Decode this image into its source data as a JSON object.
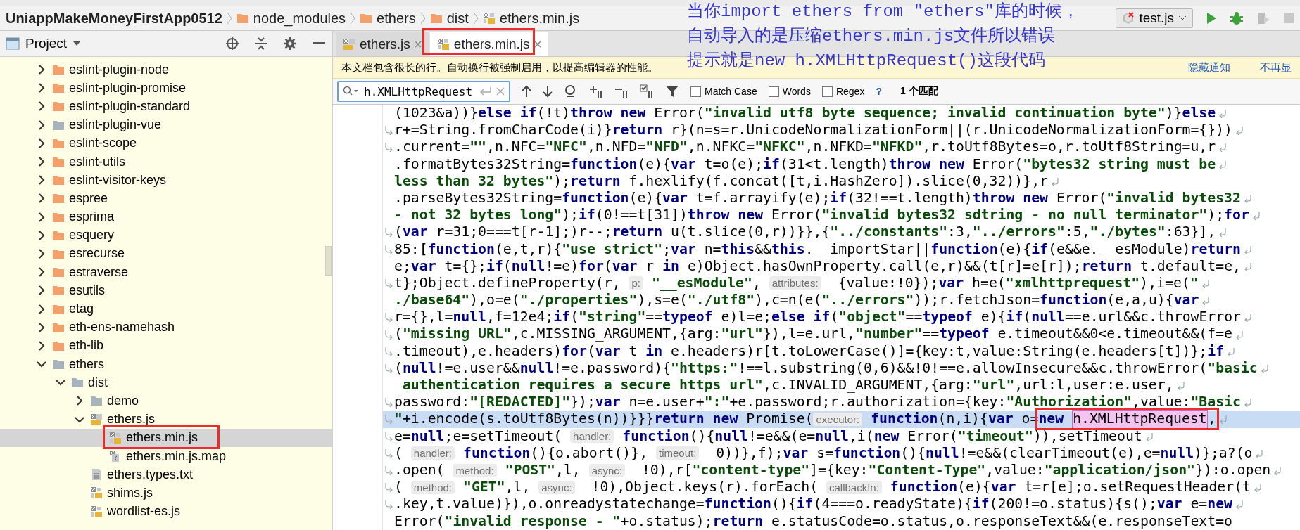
{
  "breadcrumb": [
    {
      "label": "UniappMakeMoneyFirstApp0512",
      "kind": "project"
    },
    {
      "label": "node_modules",
      "kind": "folder"
    },
    {
      "label": "ethers",
      "kind": "folder"
    },
    {
      "label": "dist",
      "kind": "folder"
    },
    {
      "label": "ethers.min.js",
      "kind": "minjs"
    }
  ],
  "run_config": {
    "label": "test.js"
  },
  "project_panel": {
    "title": "Project",
    "tree": [
      {
        "name": "eslint-plugin-node",
        "kind": "folder",
        "expanded": false,
        "selected": false
      },
      {
        "name": "eslint-plugin-promise",
        "kind": "folder",
        "expanded": false,
        "selected": false
      },
      {
        "name": "eslint-plugin-standard",
        "kind": "folder",
        "expanded": false,
        "selected": false
      },
      {
        "name": "eslint-plugin-vue",
        "kind": "greyfolder",
        "expanded": false,
        "selected": false
      },
      {
        "name": "eslint-scope",
        "kind": "folder",
        "expanded": false,
        "selected": false
      },
      {
        "name": "eslint-utils",
        "kind": "folder",
        "expanded": false,
        "selected": false
      },
      {
        "name": "eslint-visitor-keys",
        "kind": "folder",
        "expanded": false,
        "selected": false
      },
      {
        "name": "espree",
        "kind": "folder",
        "expanded": false,
        "selected": false
      },
      {
        "name": "esprima",
        "kind": "folder",
        "expanded": false,
        "selected": false
      },
      {
        "name": "esquery",
        "kind": "folder",
        "expanded": false,
        "selected": false
      },
      {
        "name": "esrecurse",
        "kind": "folder",
        "expanded": false,
        "selected": false
      },
      {
        "name": "estraverse",
        "kind": "folder",
        "expanded": false,
        "selected": false
      },
      {
        "name": "esutils",
        "kind": "folder",
        "expanded": false,
        "selected": false
      },
      {
        "name": "etag",
        "kind": "folder",
        "expanded": false,
        "selected": false
      },
      {
        "name": "eth-ens-namehash",
        "kind": "folder",
        "expanded": false,
        "selected": false
      },
      {
        "name": "eth-lib",
        "kind": "folder",
        "expanded": false,
        "selected": false
      },
      {
        "name": "ethers",
        "kind": "greyfolder",
        "expanded": true,
        "selected": false,
        "children": [
          {
            "name": "dist",
            "kind": "greyfolder",
            "expanded": true,
            "selected": false,
            "children": [
              {
                "name": "demo",
                "kind": "greyfolder",
                "expanded": false,
                "selected": false
              },
              {
                "name": "ethers.js",
                "kind": "js",
                "expanded": true,
                "selected": false,
                "children": [
                  {
                    "name": "ethers.min.js",
                    "kind": "minjs",
                    "selected": true
                  },
                  {
                    "name": "ethers.min.js.map",
                    "kind": "map",
                    "selected": false
                  }
                ]
              },
              {
                "name": "ethers.types.txt",
                "kind": "text",
                "selected": false
              },
              {
                "name": "shims.js",
                "kind": "minjs",
                "selected": false
              },
              {
                "name": "wordlist-es.js",
                "kind": "minjs",
                "selected": false
              }
            ]
          }
        ]
      }
    ]
  },
  "editor_tabs": [
    {
      "label": "ethers.js",
      "kind": "js",
      "selected": false
    },
    {
      "label": "ethers.min.js",
      "kind": "minjs",
      "selected": true
    }
  ],
  "notification": {
    "message": "本文档包含很长的行。自动换行被强制启用，以提高编辑器的性能。",
    "actions": [
      "隐藏通知",
      "不再显"
    ]
  },
  "search": {
    "value": "h.XMLHttpRequest",
    "options": [
      {
        "label": "Match Case",
        "checked": false
      },
      {
        "label": "Words",
        "checked": false
      },
      {
        "label": "Regex",
        "checked": false
      }
    ],
    "help": "?",
    "result": "1 个匹配"
  },
  "code_lines": [
    {
      "wrap_mark": false,
      "current": false,
      "tokens": [
        {
          "kind": "plain",
          "text": "(1023&a))}"
        },
        {
          "kind": "keyword",
          "text": "else if"
        },
        {
          "kind": "plain",
          "text": "(!t)"
        },
        {
          "kind": "keyword",
          "text": "throw new"
        },
        {
          "kind": "plain",
          "text": " Error("
        },
        {
          "kind": "string",
          "text": "\"invalid utf8 byte sequence; invalid continuation byte\""
        },
        {
          "kind": "plain",
          "text": ")}"
        },
        {
          "kind": "keyword",
          "text": "else"
        }
      ]
    },
    {
      "wrap_mark": true,
      "current": false,
      "tokens": [
        {
          "kind": "plain",
          "text": "r+=String.fromCharCode(i)}"
        },
        {
          "kind": "keyword",
          "text": "return"
        },
        {
          "kind": "plain",
          "text": " r}(n=s=r.UnicodeNormalizationForm||(r.UnicodeNormalizationForm={}))"
        }
      ]
    },
    {
      "wrap_mark": true,
      "current": false,
      "tokens": [
        {
          "kind": "plain",
          "text": ".current="
        },
        {
          "kind": "string",
          "text": "\"\""
        },
        {
          "kind": "plain",
          "text": ",n.NFC="
        },
        {
          "kind": "string",
          "text": "\"NFC\""
        },
        {
          "kind": "plain",
          "text": ",n.NFD="
        },
        {
          "kind": "string",
          "text": "\"NFD\""
        },
        {
          "kind": "plain",
          "text": ",n.NFKC="
        },
        {
          "kind": "string",
          "text": "\"NFKC\""
        },
        {
          "kind": "plain",
          "text": ",n.NFKD="
        },
        {
          "kind": "string",
          "text": "\"NFKD\""
        },
        {
          "kind": "plain",
          "text": ",r.toUtf8Bytes=o,r.toUtf8String=u,r"
        }
      ]
    },
    {
      "wrap_mark": false,
      "current": false,
      "tokens": [
        {
          "kind": "plain",
          "text": ".formatBytes32String="
        },
        {
          "kind": "keyword",
          "text": "function"
        },
        {
          "kind": "plain",
          "text": "(e){"
        },
        {
          "kind": "keyword",
          "text": "var"
        },
        {
          "kind": "plain",
          "text": " t=o(e);"
        },
        {
          "kind": "keyword",
          "text": "if"
        },
        {
          "kind": "plain",
          "text": "(31<t.length)"
        },
        {
          "kind": "keyword",
          "text": "throw new"
        },
        {
          "kind": "plain",
          "text": " Error("
        },
        {
          "kind": "string",
          "text": "\"bytes32 string must be"
        }
      ]
    },
    {
      "wrap_mark": false,
      "current": false,
      "tokens": [
        {
          "kind": "string",
          "text": "less than 32 bytes\""
        },
        {
          "kind": "plain",
          "text": ");"
        },
        {
          "kind": "keyword",
          "text": "return"
        },
        {
          "kind": "plain",
          "text": " f.hexlify(f.concat([t,i.HashZero]).slice(0,32))},r"
        }
      ]
    },
    {
      "wrap_mark": false,
      "current": false,
      "tokens": [
        {
          "kind": "plain",
          "text": ".parseBytes32String="
        },
        {
          "kind": "keyword",
          "text": "function"
        },
        {
          "kind": "plain",
          "text": "(e){"
        },
        {
          "kind": "keyword",
          "text": "var"
        },
        {
          "kind": "plain",
          "text": " t=f.arrayify(e);"
        },
        {
          "kind": "keyword",
          "text": "if"
        },
        {
          "kind": "plain",
          "text": "(32!==t.length)"
        },
        {
          "kind": "keyword",
          "text": "throw new"
        },
        {
          "kind": "plain",
          "text": " Error("
        },
        {
          "kind": "string",
          "text": "\"invalid bytes32"
        }
      ]
    },
    {
      "wrap_mark": false,
      "current": false,
      "tokens": [
        {
          "kind": "string",
          "text": "- not 32 bytes long\""
        },
        {
          "kind": "plain",
          "text": ");"
        },
        {
          "kind": "keyword",
          "text": "if"
        },
        {
          "kind": "plain",
          "text": "(0!==t[31])"
        },
        {
          "kind": "keyword",
          "text": "throw new"
        },
        {
          "kind": "plain",
          "text": " Error("
        },
        {
          "kind": "string",
          "text": "\"invalid bytes32 sdtring - no null terminator\""
        },
        {
          "kind": "plain",
          "text": ");"
        },
        {
          "kind": "keyword",
          "text": "for"
        }
      ]
    },
    {
      "wrap_mark": true,
      "current": false,
      "tokens": [
        {
          "kind": "plain",
          "text": "("
        },
        {
          "kind": "keyword",
          "text": "var"
        },
        {
          "kind": "plain",
          "text": " r=31;0===t[r-1];)r--;"
        },
        {
          "kind": "keyword",
          "text": "return"
        },
        {
          "kind": "plain",
          "text": " u(t.slice(0,r))}},{"
        },
        {
          "kind": "string",
          "text": "\"../constants\""
        },
        {
          "kind": "plain",
          "text": ":3,"
        },
        {
          "kind": "string",
          "text": "\"../errors\""
        },
        {
          "kind": "plain",
          "text": ":5,"
        },
        {
          "kind": "string",
          "text": "\"./bytes\""
        },
        {
          "kind": "plain",
          "text": ":63}],"
        }
      ]
    },
    {
      "wrap_mark": true,
      "current": false,
      "tokens": [
        {
          "kind": "plain",
          "text": "85:["
        },
        {
          "kind": "keyword",
          "text": "function"
        },
        {
          "kind": "plain",
          "text": "(e,t,r){"
        },
        {
          "kind": "string",
          "text": "\"use strict\""
        },
        {
          "kind": "plain",
          "text": ";"
        },
        {
          "kind": "keyword",
          "text": "var"
        },
        {
          "kind": "plain",
          "text": " n="
        },
        {
          "kind": "keyword",
          "text": "this"
        },
        {
          "kind": "plain",
          "text": "&&"
        },
        {
          "kind": "keyword",
          "text": "this"
        },
        {
          "kind": "plain",
          "text": ".__importStar||"
        },
        {
          "kind": "keyword",
          "text": "function"
        },
        {
          "kind": "plain",
          "text": "(e){"
        },
        {
          "kind": "keyword",
          "text": "if"
        },
        {
          "kind": "plain",
          "text": "(e&&e.__esModule)"
        },
        {
          "kind": "keyword",
          "text": "return"
        }
      ]
    },
    {
      "wrap_mark": false,
      "current": false,
      "tokens": [
        {
          "kind": "plain",
          "text": "e;"
        },
        {
          "kind": "keyword",
          "text": "var"
        },
        {
          "kind": "plain",
          "text": " t={};"
        },
        {
          "kind": "keyword",
          "text": "if"
        },
        {
          "kind": "plain",
          "text": "("
        },
        {
          "kind": "keyword",
          "text": "null"
        },
        {
          "kind": "plain",
          "text": "!=e)"
        },
        {
          "kind": "keyword",
          "text": "for"
        },
        {
          "kind": "plain",
          "text": "("
        },
        {
          "kind": "keyword",
          "text": "var"
        },
        {
          "kind": "plain",
          "text": " r "
        },
        {
          "kind": "keyword",
          "text": "in"
        },
        {
          "kind": "plain",
          "text": " e)Object.hasOwnProperty.call(e,r)&&(t[r]=e[r]);"
        },
        {
          "kind": "keyword",
          "text": "return"
        },
        {
          "kind": "plain",
          "text": " t.default=e,"
        }
      ]
    },
    {
      "wrap_mark": true,
      "current": false,
      "tokens": [
        {
          "kind": "plain",
          "text": "t};Object.defineProperty(r, "
        },
        {
          "kind": "hint",
          "text": "p:"
        },
        {
          "kind": "string",
          "text": "\"__esModule\""
        },
        {
          "kind": "plain",
          "text": ", "
        },
        {
          "kind": "hint",
          "text": "attributes:"
        },
        {
          "kind": "plain",
          "text": " {value:!0});"
        },
        {
          "kind": "keyword",
          "text": "var"
        },
        {
          "kind": "plain",
          "text": " h=e("
        },
        {
          "kind": "string",
          "text": "\"xmlhttprequest\""
        },
        {
          "kind": "plain",
          "text": "),i=e("
        },
        {
          "kind": "string",
          "text": "\""
        }
      ]
    },
    {
      "wrap_mark": false,
      "current": false,
      "tokens": [
        {
          "kind": "string",
          "text": "./base64\""
        },
        {
          "kind": "plain",
          "text": "),o=e("
        },
        {
          "kind": "string",
          "text": "\"./properties\""
        },
        {
          "kind": "plain",
          "text": "),s=e("
        },
        {
          "kind": "string",
          "text": "\"./utf8\""
        },
        {
          "kind": "plain",
          "text": "),c=n(e("
        },
        {
          "kind": "string",
          "text": "\"../errors\""
        },
        {
          "kind": "plain",
          "text": "));r.fetchJson="
        },
        {
          "kind": "keyword",
          "text": "function"
        },
        {
          "kind": "plain",
          "text": "(e,a,u){"
        },
        {
          "kind": "keyword",
          "text": "var"
        }
      ]
    },
    {
      "wrap_mark": true,
      "current": false,
      "tokens": [
        {
          "kind": "plain",
          "text": "r={},l="
        },
        {
          "kind": "keyword",
          "text": "null"
        },
        {
          "kind": "plain",
          "text": ",f=12e4;"
        },
        {
          "kind": "keyword",
          "text": "if"
        },
        {
          "kind": "plain",
          "text": "("
        },
        {
          "kind": "string",
          "text": "\"string\""
        },
        {
          "kind": "plain",
          "text": "=="
        },
        {
          "kind": "keyword",
          "text": "typeof"
        },
        {
          "kind": "plain",
          "text": " e)l=e;"
        },
        {
          "kind": "keyword",
          "text": "else if"
        },
        {
          "kind": "plain",
          "text": "("
        },
        {
          "kind": "string",
          "text": "\"object\""
        },
        {
          "kind": "plain",
          "text": "=="
        },
        {
          "kind": "keyword",
          "text": "typeof"
        },
        {
          "kind": "plain",
          "text": " e){"
        },
        {
          "kind": "keyword",
          "text": "if"
        },
        {
          "kind": "plain",
          "text": "("
        },
        {
          "kind": "keyword",
          "text": "null"
        },
        {
          "kind": "plain",
          "text": "==e.url&&c.throwError"
        }
      ]
    },
    {
      "wrap_mark": true,
      "current": false,
      "tokens": [
        {
          "kind": "plain",
          "text": "("
        },
        {
          "kind": "string",
          "text": "\"missing URL\""
        },
        {
          "kind": "plain",
          "text": ",c.MISSING_ARGUMENT,{arg:"
        },
        {
          "kind": "string",
          "text": "\"url\""
        },
        {
          "kind": "plain",
          "text": "}),l=e.url,"
        },
        {
          "kind": "string",
          "text": "\"number\""
        },
        {
          "kind": "plain",
          "text": "=="
        },
        {
          "kind": "keyword",
          "text": "typeof"
        },
        {
          "kind": "plain",
          "text": " e.timeout&&0<e.timeout&&(f=e"
        }
      ]
    },
    {
      "wrap_mark": true,
      "current": false,
      "tokens": [
        {
          "kind": "plain",
          "text": ".timeout),e.headers)"
        },
        {
          "kind": "keyword",
          "text": "for"
        },
        {
          "kind": "plain",
          "text": "("
        },
        {
          "kind": "keyword",
          "text": "var"
        },
        {
          "kind": "plain",
          "text": " t "
        },
        {
          "kind": "keyword",
          "text": "in"
        },
        {
          "kind": "plain",
          "text": " e.headers)r[t.toLowerCase()]={key:t,value:String(e.headers[t])};"
        },
        {
          "kind": "keyword",
          "text": "if"
        }
      ]
    },
    {
      "wrap_mark": true,
      "current": false,
      "tokens": [
        {
          "kind": "plain",
          "text": "("
        },
        {
          "kind": "keyword",
          "text": "null"
        },
        {
          "kind": "plain",
          "text": "!=e.user&&"
        },
        {
          "kind": "keyword",
          "text": "null"
        },
        {
          "kind": "plain",
          "text": "!=e.password){"
        },
        {
          "kind": "string",
          "text": "\"https:\""
        },
        {
          "kind": "plain",
          "text": "!==l.substring(0,6)&&!0!==e.allowInsecure&&c.throwError("
        },
        {
          "kind": "string",
          "text": "\"basic"
        }
      ]
    },
    {
      "wrap_mark": false,
      "current": false,
      "tokens": [
        {
          "kind": "string",
          "text": " authentication requires a secure https url\""
        },
        {
          "kind": "plain",
          "text": ",c.INVALID_ARGUMENT,{arg:"
        },
        {
          "kind": "string",
          "text": "\"url\""
        },
        {
          "kind": "plain",
          "text": ",url:l,user:e.user,"
        }
      ]
    },
    {
      "wrap_mark": true,
      "current": false,
      "tokens": [
        {
          "kind": "plain",
          "text": "password:"
        },
        {
          "kind": "string",
          "text": "\"[REDACTED]\""
        },
        {
          "kind": "plain",
          "text": "});"
        },
        {
          "kind": "keyword",
          "text": "var"
        },
        {
          "kind": "plain",
          "text": " n=e.user+"
        },
        {
          "kind": "string",
          "text": "\":\""
        },
        {
          "kind": "plain",
          "text": "+e.password;r.authorization={key:"
        },
        {
          "kind": "string",
          "text": "\"Authorization\""
        },
        {
          "kind": "plain",
          "text": ",value:"
        },
        {
          "kind": "string",
          "text": "\"Basic"
        }
      ]
    },
    {
      "wrap_mark": true,
      "current": true,
      "tokens": [
        {
          "kind": "string",
          "text": "\""
        },
        {
          "kind": "plain",
          "text": "+i.encode(s.toUtf8Bytes(n))}}}"
        },
        {
          "kind": "keyword",
          "text": "return new"
        },
        {
          "kind": "plain",
          "text": " Promise("
        },
        {
          "kind": "hint",
          "text": "executor:"
        },
        {
          "kind": "keyword",
          "text": "function"
        },
        {
          "kind": "plain",
          "text": "(n,i){"
        },
        {
          "kind": "keyword",
          "text": "var"
        },
        {
          "kind": "plain",
          "text": " o="
        },
        {
          "kind": "keyword",
          "text": "new"
        },
        {
          "kind": "match",
          "text": "h.XMLHttpRequest"
        },
        {
          "kind": "plain",
          "text": ","
        }
      ]
    },
    {
      "wrap_mark": true,
      "current": false,
      "tokens": [
        {
          "kind": "plain",
          "text": "e="
        },
        {
          "kind": "keyword",
          "text": "null"
        },
        {
          "kind": "plain",
          "text": ";e=setTimeout( "
        },
        {
          "kind": "hint",
          "text": "handler:"
        },
        {
          "kind": "keyword",
          "text": "function"
        },
        {
          "kind": "plain",
          "text": "(){"
        },
        {
          "kind": "keyword",
          "text": "null"
        },
        {
          "kind": "plain",
          "text": "!=e&&(e="
        },
        {
          "kind": "keyword",
          "text": "null"
        },
        {
          "kind": "plain",
          "text": ",i("
        },
        {
          "kind": "keyword",
          "text": "new"
        },
        {
          "kind": "plain",
          "text": " Error("
        },
        {
          "kind": "string",
          "text": "\"timeout\""
        },
        {
          "kind": "plain",
          "text": ")),setTimeout"
        }
      ]
    },
    {
      "wrap_mark": true,
      "current": false,
      "tokens": [
        {
          "kind": "plain",
          "text": "( "
        },
        {
          "kind": "hint",
          "text": "handler:"
        },
        {
          "kind": "keyword",
          "text": "function"
        },
        {
          "kind": "plain",
          "text": "(){o.abort()}, "
        },
        {
          "kind": "hint",
          "text": "timeout:"
        },
        {
          "kind": "plain",
          "text": " 0))},f);"
        },
        {
          "kind": "keyword",
          "text": "var"
        },
        {
          "kind": "plain",
          "text": " s="
        },
        {
          "kind": "keyword",
          "text": "function"
        },
        {
          "kind": "plain",
          "text": "(){"
        },
        {
          "kind": "keyword",
          "text": "null"
        },
        {
          "kind": "plain",
          "text": "!=e&&(clearTimeout(e),e="
        },
        {
          "kind": "keyword",
          "text": "null"
        },
        {
          "kind": "plain",
          "text": ")};a?(o"
        }
      ]
    },
    {
      "wrap_mark": true,
      "current": false,
      "tokens": [
        {
          "kind": "plain",
          "text": ".open( "
        },
        {
          "kind": "hint",
          "text": "method:"
        },
        {
          "kind": "string",
          "text": "\"POST\""
        },
        {
          "kind": "plain",
          "text": ",l, "
        },
        {
          "kind": "hint",
          "text": "async:"
        },
        {
          "kind": "plain",
          "text": " !0),r["
        },
        {
          "kind": "string",
          "text": "\"content-type\""
        },
        {
          "kind": "plain",
          "text": "]={key:"
        },
        {
          "kind": "string",
          "text": "\"Content-Type\""
        },
        {
          "kind": "plain",
          "text": ",value:"
        },
        {
          "kind": "string",
          "text": "\"application/json\""
        },
        {
          "kind": "plain",
          "text": "}):o.open"
        }
      ]
    },
    {
      "wrap_mark": true,
      "current": false,
      "tokens": [
        {
          "kind": "plain",
          "text": "( "
        },
        {
          "kind": "hint",
          "text": "method:"
        },
        {
          "kind": "string",
          "text": "\"GET\""
        },
        {
          "kind": "plain",
          "text": ",l, "
        },
        {
          "kind": "hint",
          "text": "async:"
        },
        {
          "kind": "plain",
          "text": " !0),Object.keys(r).forEach( "
        },
        {
          "kind": "hint",
          "text": "callbackfn:"
        },
        {
          "kind": "keyword",
          "text": "function"
        },
        {
          "kind": "plain",
          "text": "(e){"
        },
        {
          "kind": "keyword",
          "text": "var"
        },
        {
          "kind": "plain",
          "text": " t=r[e];o.setRequestHeader(t"
        }
      ]
    },
    {
      "wrap_mark": true,
      "current": false,
      "tokens": [
        {
          "kind": "plain",
          "text": ".key,t.value)}),o.onreadystatechange="
        },
        {
          "kind": "keyword",
          "text": "function"
        },
        {
          "kind": "plain",
          "text": "(){"
        },
        {
          "kind": "keyword",
          "text": "if"
        },
        {
          "kind": "plain",
          "text": "(4===o.readyState){"
        },
        {
          "kind": "keyword",
          "text": "if"
        },
        {
          "kind": "plain",
          "text": "(200!=o.status){s();"
        },
        {
          "kind": "keyword",
          "text": "var"
        },
        {
          "kind": "plain",
          "text": " e="
        },
        {
          "kind": "keyword",
          "text": "new"
        }
      ]
    },
    {
      "wrap_mark": false,
      "current": false,
      "tokens": [
        {
          "kind": "plain",
          "text": "Error("
        },
        {
          "kind": "string",
          "text": "\"invalid response - \""
        },
        {
          "kind": "plain",
          "text": "+o.status);"
        },
        {
          "kind": "keyword",
          "text": "return"
        },
        {
          "kind": "plain",
          "text": " e.statusCode=o.status,o.responseText&&(e.responseText=o"
        }
      ]
    }
  ],
  "annotation": {
    "lines": [
      "当你import ethers from \"ethers\"库的时候，",
      "自动导入的是压缩ethers.min.js文件所以错误",
      "提示就是new h.XMLHttpRequest()这段代码"
    ]
  }
}
